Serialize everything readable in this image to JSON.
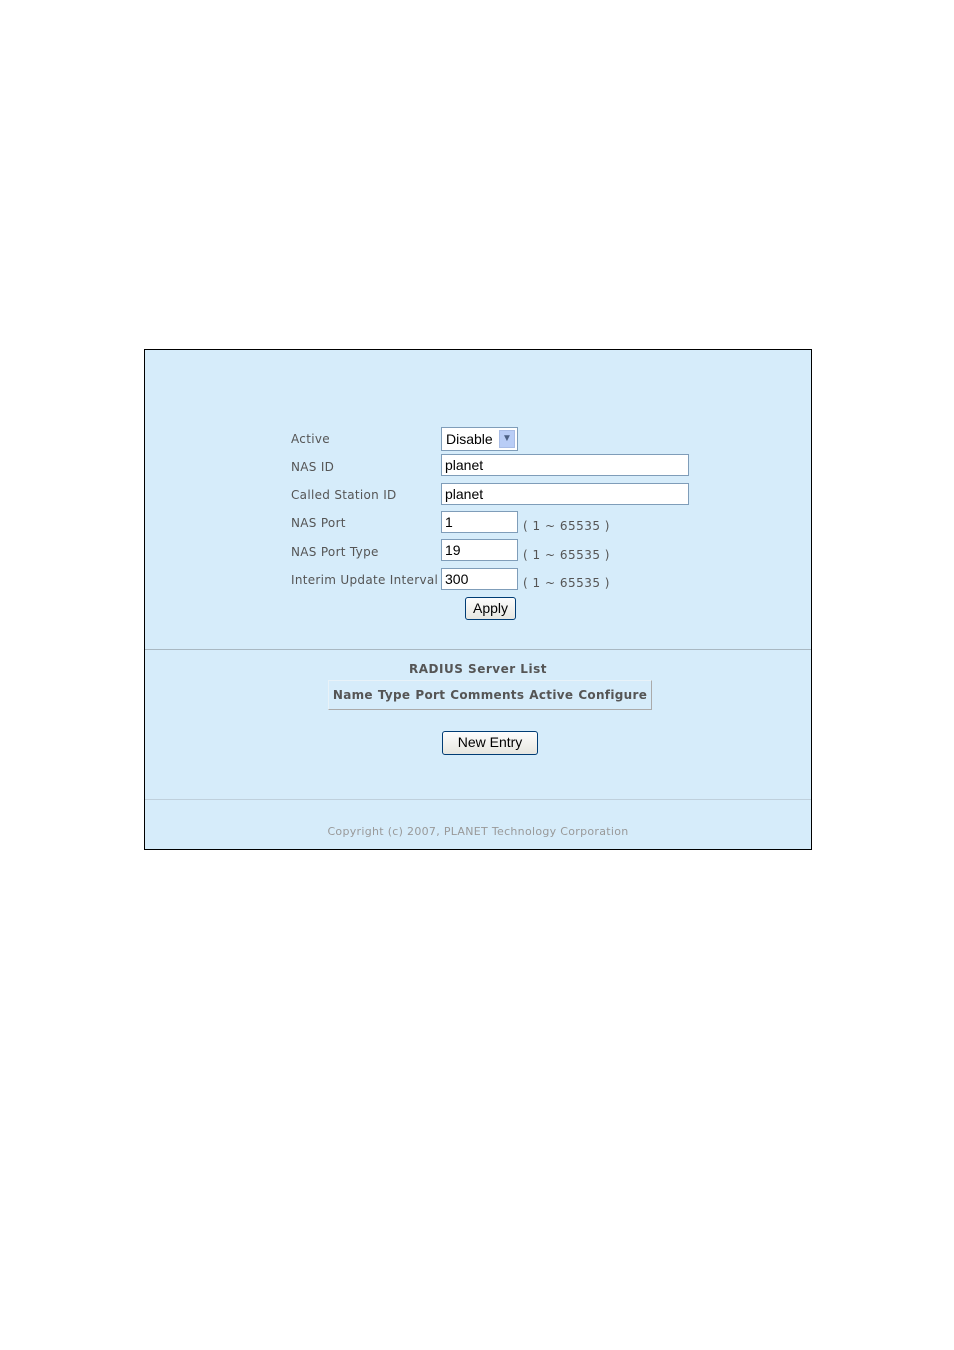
{
  "form": {
    "active": {
      "label": "Active",
      "value": "Disable"
    },
    "nas_id": {
      "label": "NAS ID",
      "value": "planet"
    },
    "called_station_id": {
      "label": "Called Station ID",
      "value": "planet"
    },
    "nas_port": {
      "label": "NAS Port",
      "value": "1",
      "range": "( 1 ~ 65535 )"
    },
    "nas_port_type": {
      "label": "NAS Port Type",
      "value": "19",
      "range": "( 1 ~ 65535 )"
    },
    "interim_update_interval": {
      "label": "Interim Update Interval",
      "value": "300",
      "range": "( 1 ~ 65535 )"
    },
    "apply_label": "Apply"
  },
  "server_list": {
    "title": "RADIUS Server List",
    "columns": [
      "Name",
      "Type",
      "Port",
      "Comments",
      "Active",
      "Configure"
    ],
    "new_entry_label": "New Entry"
  },
  "footer": {
    "copyright": "Copyright (c) 2007, PLANET Technology Corporation"
  },
  "icons": {
    "select_arrow": "⌄"
  }
}
